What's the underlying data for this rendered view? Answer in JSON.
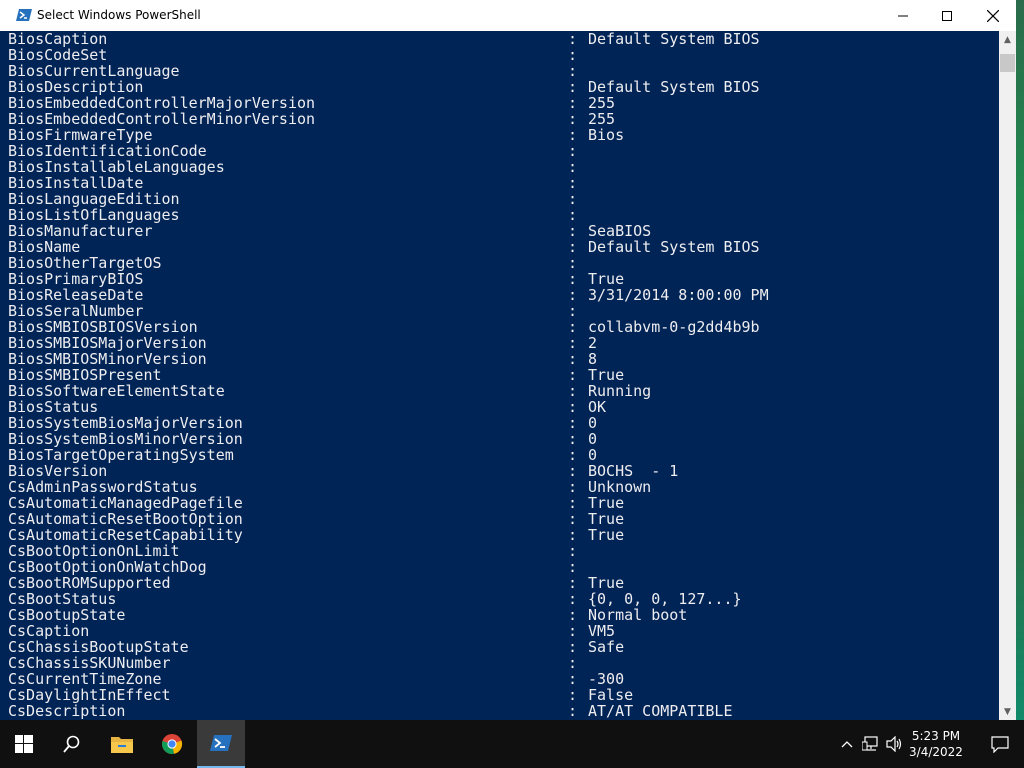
{
  "window": {
    "title": "Select Windows PowerShell"
  },
  "controls": {
    "minimize": "—",
    "maximize": "☐",
    "close": "✕"
  },
  "console": {
    "lines": [
      {
        "name": "BiosCaption",
        "sep": ":",
        "value": "Default System BIOS"
      },
      {
        "name": "BiosCodeSet",
        "sep": ":",
        "value": ""
      },
      {
        "name": "BiosCurrentLanguage",
        "sep": ":",
        "value": ""
      },
      {
        "name": "BiosDescription",
        "sep": ":",
        "value": "Default System BIOS"
      },
      {
        "name": "BiosEmbeddedControllerMajorVersion",
        "sep": ":",
        "value": "255"
      },
      {
        "name": "BiosEmbeddedControllerMinorVersion",
        "sep": ":",
        "value": "255"
      },
      {
        "name": "BiosFirmwareType",
        "sep": ":",
        "value": "Bios"
      },
      {
        "name": "BiosIdentificationCode",
        "sep": ":",
        "value": ""
      },
      {
        "name": "BiosInstallableLanguages",
        "sep": ":",
        "value": ""
      },
      {
        "name": "BiosInstallDate",
        "sep": ":",
        "value": ""
      },
      {
        "name": "BiosLanguageEdition",
        "sep": ":",
        "value": ""
      },
      {
        "name": "BiosListOfLanguages",
        "sep": ":",
        "value": ""
      },
      {
        "name": "BiosManufacturer",
        "sep": ":",
        "value": "SeaBIOS"
      },
      {
        "name": "BiosName",
        "sep": ":",
        "value": "Default System BIOS"
      },
      {
        "name": "BiosOtherTargetOS",
        "sep": ":",
        "value": ""
      },
      {
        "name": "BiosPrimaryBIOS",
        "sep": ":",
        "value": "True"
      },
      {
        "name": "BiosReleaseDate",
        "sep": ":",
        "value": "3/31/2014 8:00:00 PM"
      },
      {
        "name": "BiosSeralNumber",
        "sep": ":",
        "value": ""
      },
      {
        "name": "BiosSMBIOSBIOSVersion",
        "sep": ":",
        "value": "collabvm-0-g2dd4b9b"
      },
      {
        "name": "BiosSMBIOSMajorVersion",
        "sep": ":",
        "value": "2"
      },
      {
        "name": "BiosSMBIOSMinorVersion",
        "sep": ":",
        "value": "8"
      },
      {
        "name": "BiosSMBIOSPresent",
        "sep": ":",
        "value": "True"
      },
      {
        "name": "BiosSoftwareElementState",
        "sep": ":",
        "value": "Running"
      },
      {
        "name": "BiosStatus",
        "sep": ":",
        "value": "OK"
      },
      {
        "name": "BiosSystemBiosMajorVersion",
        "sep": ":",
        "value": "0"
      },
      {
        "name": "BiosSystemBiosMinorVersion",
        "sep": ":",
        "value": "0"
      },
      {
        "name": "BiosTargetOperatingSystem",
        "sep": ":",
        "value": "0"
      },
      {
        "name": "BiosVersion",
        "sep": ":",
        "value": "BOCHS  - 1"
      },
      {
        "name": "CsAdminPasswordStatus",
        "sep": ":",
        "value": "Unknown"
      },
      {
        "name": "CsAutomaticManagedPagefile",
        "sep": ":",
        "value": "True"
      },
      {
        "name": "CsAutomaticResetBootOption",
        "sep": ":",
        "value": "True"
      },
      {
        "name": "CsAutomaticResetCapability",
        "sep": ":",
        "value": "True"
      },
      {
        "name": "CsBootOptionOnLimit",
        "sep": ":",
        "value": ""
      },
      {
        "name": "CsBootOptionOnWatchDog",
        "sep": ":",
        "value": ""
      },
      {
        "name": "CsBootROMSupported",
        "sep": ":",
        "value": "True"
      },
      {
        "name": "CsBootStatus",
        "sep": ":",
        "value": "{0, 0, 0, 127...}"
      },
      {
        "name": "CsBootupState",
        "sep": ":",
        "value": "Normal boot"
      },
      {
        "name": "CsCaption",
        "sep": ":",
        "value": "VM5"
      },
      {
        "name": "CsChassisBootupState",
        "sep": ":",
        "value": "Safe"
      },
      {
        "name": "CsChassisSKUNumber",
        "sep": ":",
        "value": ""
      },
      {
        "name": "CsCurrentTimeZone",
        "sep": ":",
        "value": "-300"
      },
      {
        "name": "CsDaylightInEffect",
        "sep": ":",
        "value": "False"
      },
      {
        "name": "CsDescription",
        "sep": ":",
        "value": "AT/AT COMPATIBLE"
      }
    ]
  },
  "taskbar": {
    "icons": [
      "windows-start-icon",
      "search-icon",
      "file-explorer-icon",
      "chrome-icon",
      "powershell-icon"
    ],
    "tray": [
      "chevron-up-icon",
      "network-icon",
      "volume-icon",
      "notifications-icon"
    ],
    "clock": {
      "time": "5:23 PM",
      "date": "3/4/2022"
    }
  },
  "colors": {
    "console_bg": "#012456",
    "console_fg": "#eeedf0",
    "taskbar_bg": "#101010",
    "active_underline": "#76b9ed"
  }
}
